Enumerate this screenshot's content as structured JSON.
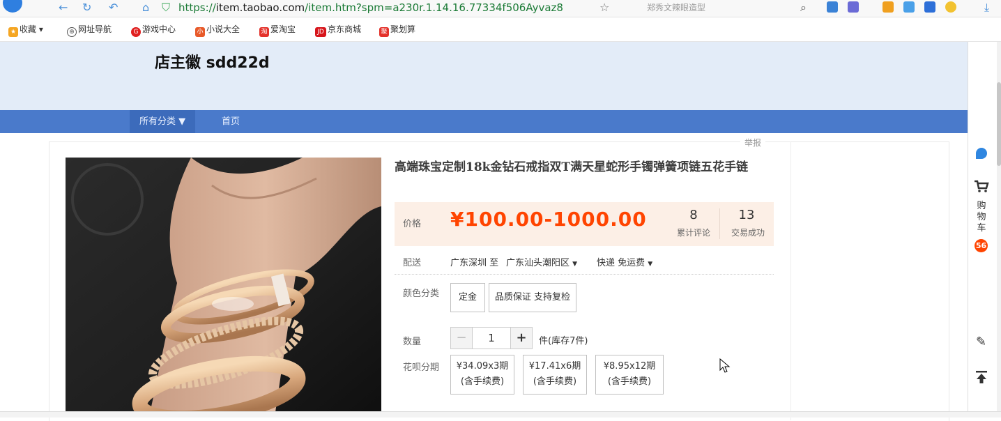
{
  "browser": {
    "url_prefix": "https://",
    "url_host": "item.taobao.com",
    "url_path": "/item.htm?spm=a230r.1.14.16.77334f506Ayvaz8",
    "search_hint": "郑秀文辣眼造型",
    "bookmarks": [
      {
        "label": "收藏",
        "icon": "star-icon",
        "color": "#f5a623"
      },
      {
        "label": "网址导航",
        "icon": "globe-icon",
        "color": "#555555"
      },
      {
        "label": "游戏中心",
        "icon": "game-icon",
        "color": "#e02020"
      },
      {
        "label": "小说大全",
        "icon": "book-icon",
        "color": "#e85a2a"
      },
      {
        "label": "爱淘宝",
        "icon": "taobao-icon",
        "color": "#e4322b"
      },
      {
        "label": "京东商城",
        "icon": "jd-icon",
        "color": "#d7161c"
      },
      {
        "label": "聚划算",
        "icon": "juhuasuan-icon",
        "color": "#e4322b"
      }
    ]
  },
  "shop": {
    "name": "店主徽 sdd22d",
    "nav": [
      "所有分类 ▼",
      "首页"
    ]
  },
  "report_label": "举报",
  "product": {
    "title": "高端珠宝定制18k金钻石戒指双T满天星蛇形手镯弹簧项链五花手链",
    "price_label": "价格",
    "price": "¥100.00-1000.00",
    "reviews": {
      "count": "8",
      "label": "累计评论"
    },
    "sales": {
      "count": "13",
      "label": "交易成功"
    },
    "shipping": {
      "label": "配送",
      "from": "广东深圳 至",
      "to": "广东汕头潮阳区",
      "method": "快递 免运费"
    },
    "color": {
      "label": "颜色分类",
      "options": [
        "定金",
        "品质保证 支持复检"
      ]
    },
    "quantity": {
      "label": "数量",
      "minus": "−",
      "value": "1",
      "plus": "+",
      "stock": "件(库存7件)"
    },
    "installments": {
      "label": "花呗分期",
      "plans": [
        {
          "amount": "¥34.09x3期",
          "fee": "(含手续费)"
        },
        {
          "amount": "¥17.41x6期",
          "fee": "(含手续费)"
        },
        {
          "amount": "¥8.95x12期",
          "fee": "(含手续费)"
        }
      ]
    }
  },
  "sidebar": {
    "cart_label": "购物车",
    "cart_count": "56"
  },
  "colors": {
    "accent": "#ff4400",
    "nav": "#4a7acb",
    "banner": "#e3ecf8"
  }
}
